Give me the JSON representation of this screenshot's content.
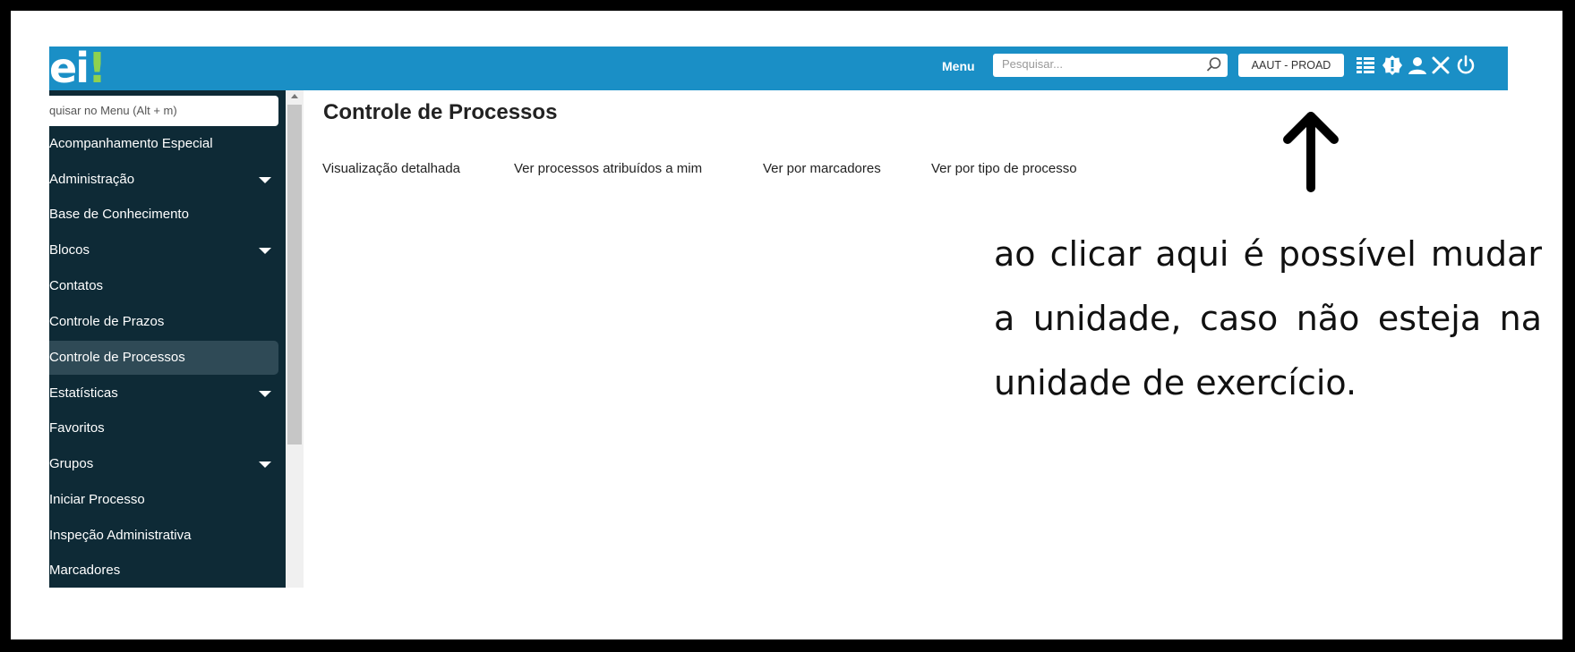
{
  "app": {
    "logo_text": "ei",
    "logo_dot": "!"
  },
  "topbar": {
    "menu_label": "Menu",
    "search_placeholder": "Pesquisar...",
    "unit_label": "AAUT - PROAD",
    "icons": [
      "grid-list-icon",
      "alert-badge-icon",
      "user-icon",
      "tools-icon",
      "power-icon"
    ]
  },
  "sidebar": {
    "search_placeholder": "quisar no Menu (Alt + m)",
    "items": [
      {
        "label": "Acompanhamento Especial",
        "has_submenu": false
      },
      {
        "label": "Administração",
        "has_submenu": true
      },
      {
        "label": "Base de Conhecimento",
        "has_submenu": false
      },
      {
        "label": "Blocos",
        "has_submenu": true
      },
      {
        "label": "Contatos",
        "has_submenu": false
      },
      {
        "label": "Controle de Prazos",
        "has_submenu": false
      },
      {
        "label": "Controle de Processos",
        "has_submenu": false,
        "active": true
      },
      {
        "label": "Estatísticas",
        "has_submenu": true
      },
      {
        "label": "Favoritos",
        "has_submenu": false
      },
      {
        "label": "Grupos",
        "has_submenu": true
      },
      {
        "label": "Iniciar Processo",
        "has_submenu": false
      },
      {
        "label": "Inspeção Administrativa",
        "has_submenu": false
      },
      {
        "label": "Marcadores",
        "has_submenu": false
      }
    ]
  },
  "main": {
    "title": "Controle de Processos",
    "tabs": [
      {
        "label": "Visualização detalhada"
      },
      {
        "label": "Ver processos atribuídos a mim"
      },
      {
        "label": "Ver por marcadores"
      },
      {
        "label": "Ver por tipo de processo"
      }
    ]
  },
  "annotation": {
    "text": "ao clicar aqui é possível mudar  a unidade, caso não esteja na unidade de exercício."
  },
  "colors": {
    "topbar": "#1a8fc6",
    "sidebar": "#0e2a36",
    "sidebar_active": "#2f4a56",
    "logo_accent": "#8fd14f"
  }
}
